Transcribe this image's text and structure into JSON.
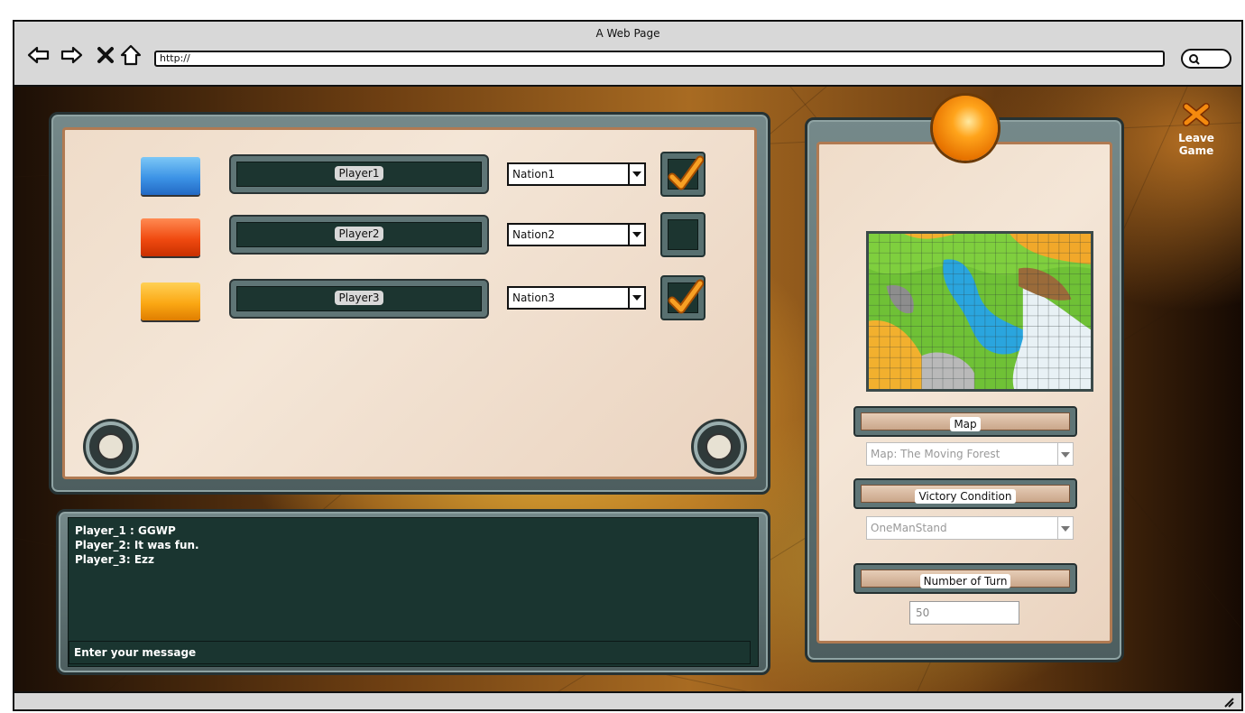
{
  "browser": {
    "window_title": "A Web Page",
    "url": "http://"
  },
  "players": [
    {
      "name": "Player1",
      "color": "#4aa8ee",
      "nation": "Nation1",
      "ready": true
    },
    {
      "name": "Player2",
      "color": "#ef4a10",
      "nation": "Nation2",
      "ready": false
    },
    {
      "name": "Player3",
      "color": "#fba814",
      "nation": "Nation3",
      "ready": true
    }
  ],
  "chat": {
    "messages": [
      "Player_1 : GGWP",
      "Player_2: It was fun.",
      "Player_3: Ezz"
    ],
    "input_placeholder": "Enter your message"
  },
  "settings": {
    "map_label": "Map",
    "map_value": "Map: The Moving Forest",
    "victory_label": "Victory Condition",
    "victory_value": "OneManStand",
    "turns_label": "Number of Turn",
    "turns_value": "50"
  },
  "leave_game": "Leave Game",
  "colors": {
    "accent_orange": "#f48a0e",
    "panel_metal": "#5f7576",
    "parchment": "#f1e2d3"
  }
}
